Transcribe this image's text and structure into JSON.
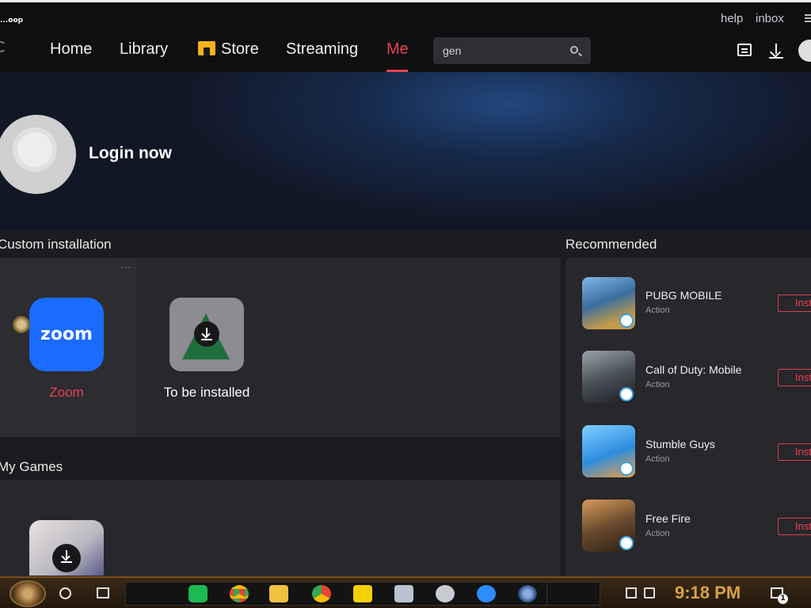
{
  "app": {
    "logo": "...oop"
  },
  "nav": {
    "home": "Home",
    "library": "Library",
    "store": "Store",
    "streaming": "Streaming",
    "me": "Me",
    "active": "Me"
  },
  "search": {
    "value": "gen"
  },
  "header_links": {
    "help": "help",
    "inbox": "inbox"
  },
  "profile": {
    "login": "Login now"
  },
  "sections": {
    "custom_installation": "Custom installation",
    "my_games": "My Games",
    "recommended": "Recommended"
  },
  "custom_installation": {
    "more": "···",
    "items": [
      {
        "label": "Zoom",
        "logo_text": "zoom",
        "color": "#e8414f"
      },
      {
        "label": "To be installed",
        "color": "#ffffff"
      }
    ]
  },
  "recommended": {
    "install_label": "Insta",
    "items": [
      {
        "name": "PUBG MOBILE",
        "genre": "Action"
      },
      {
        "name": "Call of Duty: Mobile",
        "genre": "Action"
      },
      {
        "name": "Stumble Guys",
        "genre": "Action"
      },
      {
        "name": "Free Fire",
        "genre": "Action"
      }
    ]
  },
  "taskbar": {
    "clock": "9:18 PM",
    "notification_count": "1",
    "apps": [
      "spotify-icon",
      "chrome-icon",
      "file-explorer-icon",
      "chrome-beta-icon",
      "sticky-notes-icon",
      "game-icon",
      "circle-app-icon",
      "zoom-icon",
      "orb-app-icon"
    ]
  },
  "colors": {
    "accent": "#e8414f",
    "background": "#1c1c20",
    "panel": "#27272c",
    "clock": "#d6a240"
  }
}
